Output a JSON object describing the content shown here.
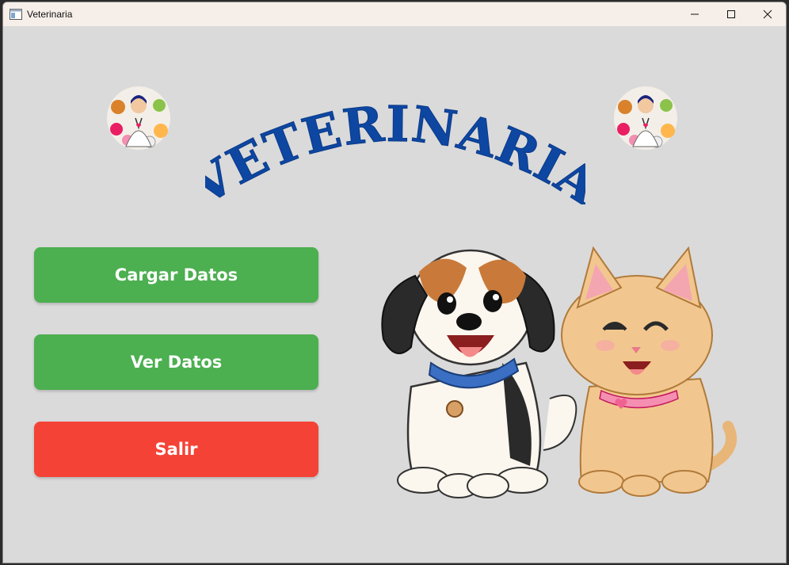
{
  "window": {
    "title": "Veterinaria"
  },
  "header": {
    "logo_text": "VETERINARIA",
    "logo_color": "#0d47a1"
  },
  "buttons": {
    "load_label": "Cargar Datos",
    "view_label": "Ver Datos",
    "exit_label": "Salir"
  },
  "colors": {
    "button_green": "#4caf50",
    "button_red": "#f44336",
    "background": "#dadada",
    "titlebar": "#f6efe9"
  },
  "icons": [
    "app-window-icon",
    "minimize-icon",
    "maximize-icon",
    "close-icon",
    "veterinarian-badge-icon"
  ]
}
